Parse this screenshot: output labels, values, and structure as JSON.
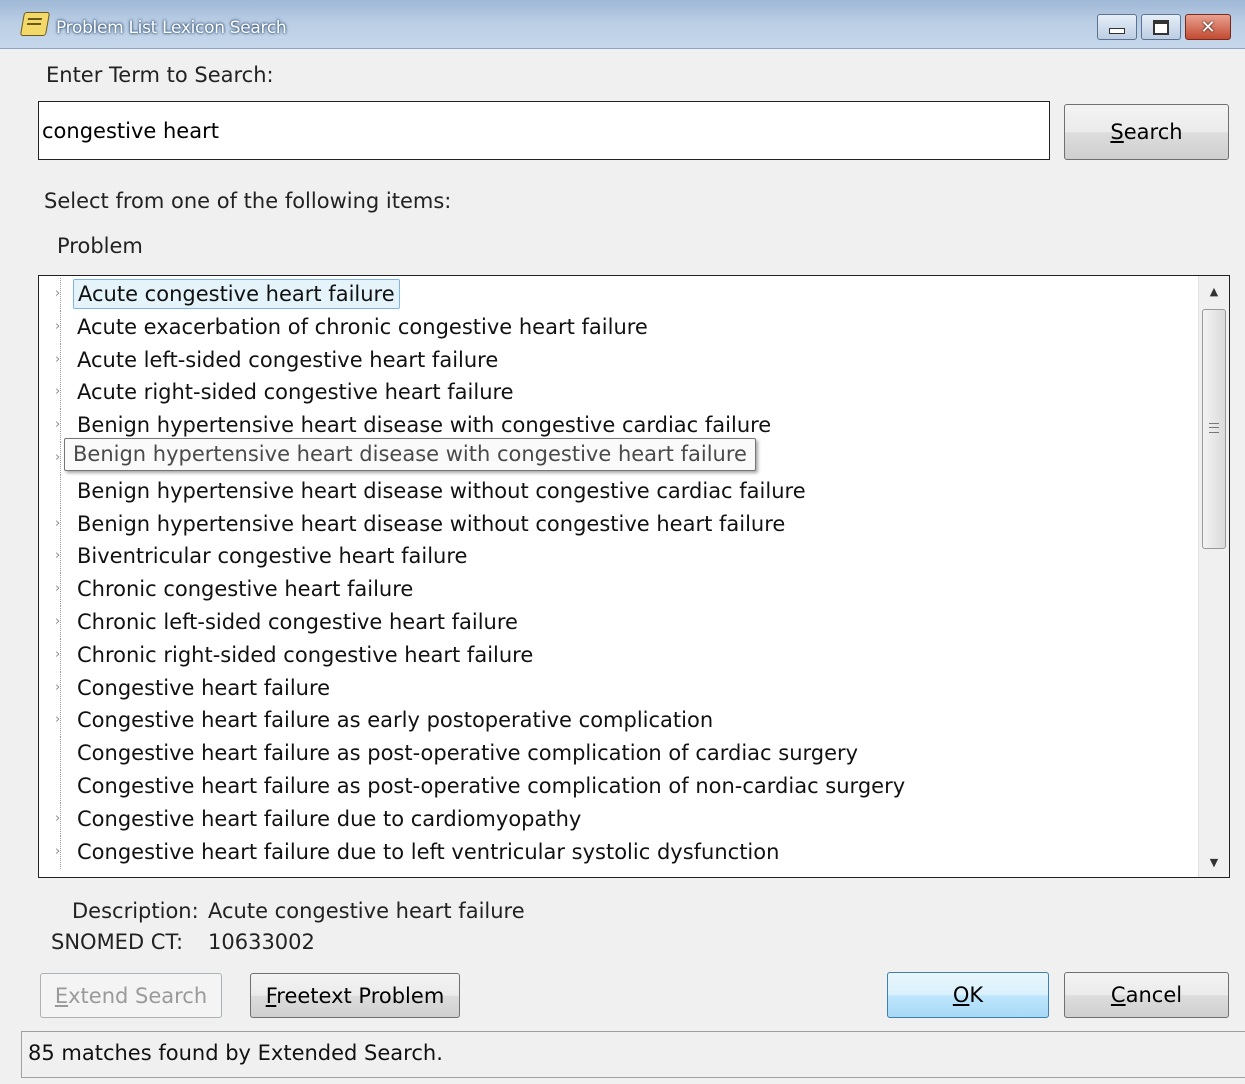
{
  "window": {
    "title": "Problem List  Lexicon Search"
  },
  "search": {
    "prompt_label": "Enter Term to Search:",
    "value": "congestive heart",
    "button_label": "Search"
  },
  "list": {
    "instruction": "Select from one of the following items:",
    "column_header": "Problem",
    "items": [
      {
        "label": "Acute congestive heart failure",
        "expandable": true,
        "selected": true
      },
      {
        "label": "Acute exacerbation of chronic congestive heart failure",
        "expandable": true
      },
      {
        "label": "Acute left-sided congestive heart failure",
        "expandable": true
      },
      {
        "label": "Acute right-sided congestive heart failure",
        "expandable": true
      },
      {
        "label": "Benign hypertensive heart disease with congestive cardiac failure",
        "expandable": true
      },
      {
        "label": "Benign hypertensive heart disease with congestive heart failure",
        "expandable": true
      },
      {
        "label": "Benign hypertensive heart disease without congestive cardiac failure",
        "expandable": false
      },
      {
        "label": "Benign hypertensive heart disease without congestive heart failure",
        "expandable": true
      },
      {
        "label": "Biventricular congestive heart failure",
        "expandable": true
      },
      {
        "label": "Chronic congestive heart failure",
        "expandable": true
      },
      {
        "label": "Chronic left-sided congestive heart failure",
        "expandable": true
      },
      {
        "label": "Chronic right-sided congestive heart failure",
        "expandable": true
      },
      {
        "label": "Congestive heart failure",
        "expandable": true
      },
      {
        "label": "Congestive heart failure as early postoperative complication",
        "expandable": true
      },
      {
        "label": "Congestive heart failure as post-operative complication of cardiac surgery",
        "expandable": false
      },
      {
        "label": "Congestive heart failure as post-operative complication of non-cardiac surgery",
        "expandable": false
      },
      {
        "label": "Congestive heart failure due to cardiomyopathy",
        "expandable": true
      },
      {
        "label": "Congestive heart failure due to left ventricular systolic dysfunction",
        "expandable": true
      }
    ],
    "tooltip": "Benign hypertensive heart disease with congestive heart failure"
  },
  "details": {
    "description_label": "Description:",
    "description_value": "Acute congestive heart failure",
    "code_label": "SNOMED CT:",
    "code_value": "10633002"
  },
  "buttons": {
    "extend_search": "Extend Search",
    "freetext_problem": "Freetext Problem",
    "ok": "OK",
    "cancel": "Cancel"
  },
  "status": {
    "text": "85 matches found by Extended Search."
  }
}
